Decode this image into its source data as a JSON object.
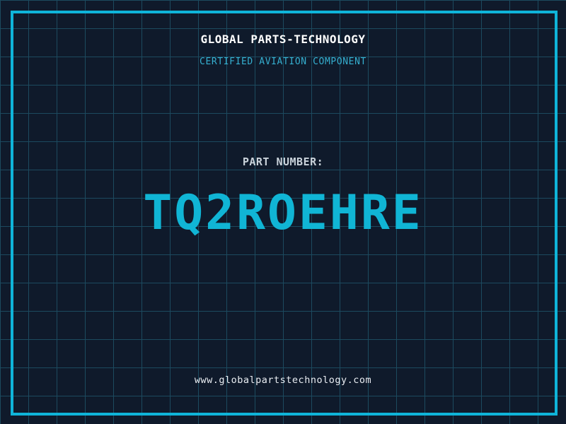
{
  "page": {
    "title": "GLOBAL PARTS-TECHNOLOGY",
    "subtitle": "CERTIFIED AVIATION COMPONENT",
    "part_label": "PART NUMBER:",
    "part_number": "TQ2ROEHRE",
    "website": "www.globalpartstechnology.com"
  },
  "colors": {
    "background": "#0F1A2B",
    "grid_line": "#1C4A5F",
    "frame": "#0FB4D9",
    "title": "#FFFFFF",
    "subtitle": "#35AFD0",
    "part_label": "#C9D2DA",
    "part_number": "#10B5D5",
    "website": "#E9EDF2"
  },
  "layout_meta": {
    "grid_cell_px": "40"
  }
}
